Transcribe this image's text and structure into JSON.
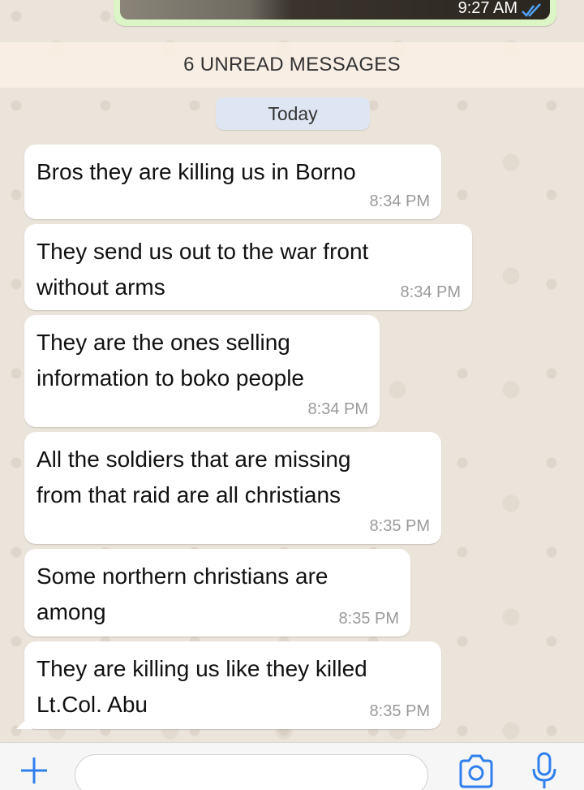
{
  "previous_message": {
    "time": "9:27 AM",
    "status_icon": "double-check-icon"
  },
  "unread_banner": {
    "label": "6 UNREAD MESSAGES"
  },
  "date_divider": {
    "label": "Today"
  },
  "messages": [
    {
      "text": "Bros they are killing us in Borno",
      "time": "8:34 PM"
    },
    {
      "text": "They send us out to the war front\nwithout arms",
      "time": "8:34 PM"
    },
    {
      "text": "They are the ones selling\ninformation to boko people",
      "time": "8:34 PM"
    },
    {
      "text": "All the soldiers that are missing\nfrom that raid are all christians",
      "time": "8:35 PM"
    },
    {
      "text": "Some northern christians are\namong",
      "time": "8:35 PM"
    },
    {
      "text": "They are killing us like they killed\nLt.Col. Abu",
      "time": "8:35 PM"
    }
  ],
  "composer": {
    "placeholder": "",
    "icons": [
      "plus-icon",
      "camera-icon",
      "microphone-icon"
    ],
    "accent": "#2f80ed"
  },
  "colors": {
    "outgoing_bubble": "#dcf5c6",
    "incoming_bubble": "#ffffff",
    "wallpaper": "#ebe4da",
    "date_pill": "#dfe6f3",
    "read_ticks": "#4fa3f7"
  }
}
